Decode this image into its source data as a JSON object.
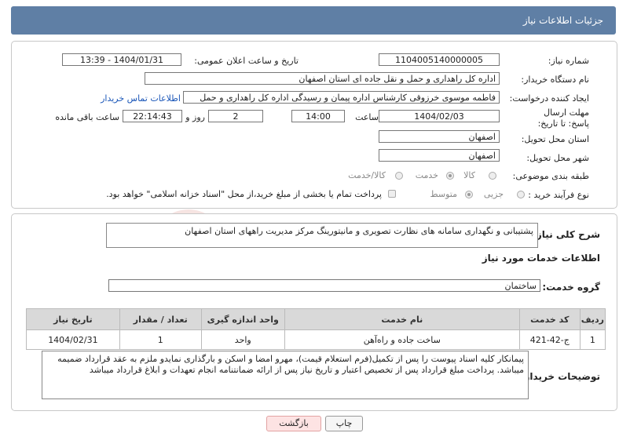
{
  "header": {
    "title": "جزئیات اطلاعات نیاز"
  },
  "form": {
    "need_number_label": "شماره نیاز:",
    "need_number": "1104005140000005",
    "announce_label": "تاریخ و ساعت اعلان عمومی:",
    "announce_value": "1404/01/31 - 13:39",
    "buyer_label": "نام دستگاه خریدار:",
    "buyer_value": "اداره کل راهداری و حمل و نقل جاده ای استان اصفهان",
    "creator_label": "ایجاد کننده درخواست:",
    "creator_value": "فاطمه موسوی خرزوقی کارشناس اداره پیمان و رسیدگی اداره کل راهداری و حمل",
    "contact_link": "اطلاعات تماس خریدار",
    "deadline_label": "مهلت ارسال پاسخ: تا تاریخ:",
    "deadline_date": "1404/02/03",
    "time_label": "ساعت",
    "deadline_time": "14:00",
    "days_value": "2",
    "days_label": "روز و",
    "remaining_time": "22:14:43",
    "remaining_label": "ساعت باقی مانده",
    "province_label": "استان محل تحویل:",
    "province_value": "اصفهان",
    "city_label": "شهر محل تحویل:",
    "city_value": "اصفهان",
    "category_label": "طبقه بندی موضوعی:",
    "category_options": [
      "کالا",
      "خدمت",
      "کالا/خدمت"
    ],
    "category_selected": "خدمت",
    "process_label": "نوع فرآیند خرید :",
    "process_options": [
      "جزیی",
      "متوسط"
    ],
    "process_selected": "متوسط",
    "payment_note": "پرداخت تمام یا بخشی از مبلغ خرید،از محل \"اسناد خزانه اسلامی\" خواهد بود."
  },
  "details": {
    "summary_label": "شرح کلی نیاز:",
    "summary_value": "پشتیبانی و نگهداری سامانه های نظارت تصویری و مانیتورینگ مرکز مدیریت راههای استان اصفهان",
    "services_title": "اطلاعات خدمات مورد نیاز",
    "group_label": "گروه خدمت:",
    "group_value": "ساختمان",
    "table_headers": [
      "ردیف",
      "کد خدمت",
      "نام خدمت",
      "واحد اندازه گیری",
      "تعداد / مقدار",
      "تاریخ نیاز"
    ],
    "table_rows": [
      {
        "row": "1",
        "code": "ج-42-421",
        "name": "ساخت جاده و راه‌آهن",
        "unit": "واحد",
        "qty": "1",
        "date": "1404/02/31"
      }
    ],
    "buyer_notes_label": "توضیحات خریدار:",
    "buyer_notes": "پیمانکار کلیه اسناد پیوست را پس از تکمیل(فرم استعلام قیمت)، مهرو امضا و اسکن و بارگذاری نمایدو ملزم به عقد قرارداد ضمیمه میباشد. پرداخت مبلغ قرارداد پس از تخصیص اعتبار و تاریخ نیاز پس از ارائه ضمانتنامه انجام تعهدات و ابلاغ قرارداد میباشد"
  },
  "buttons": {
    "print": "چاپ",
    "back": "بازگشت"
  },
  "watermark": {
    "text": "AriaTender.neT"
  }
}
